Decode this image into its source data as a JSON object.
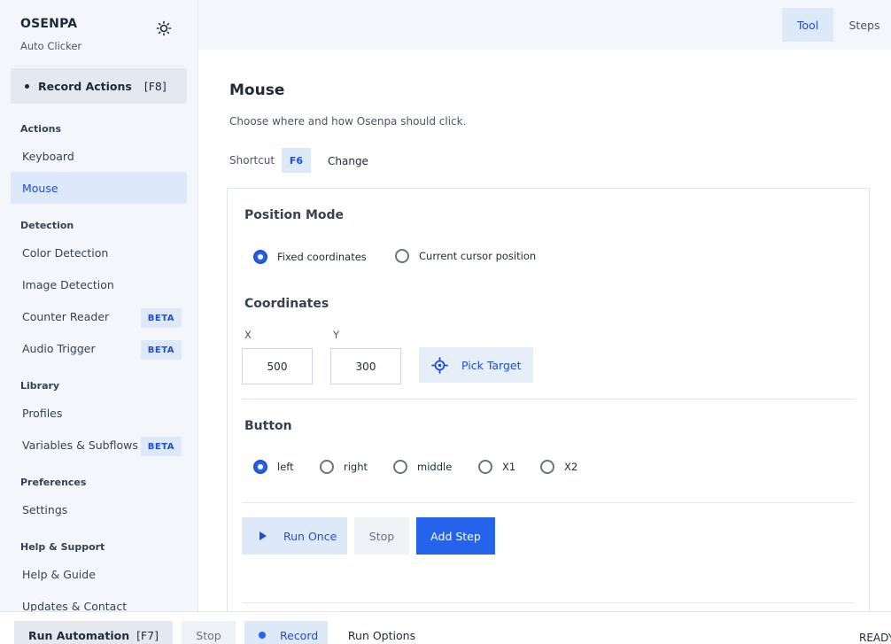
{
  "app": {
    "name": "OSENPA",
    "subtitle": "Auto Clicker"
  },
  "sidebar": {
    "record_actions": {
      "label": "Record Actions",
      "key": "[F8]"
    },
    "sections": {
      "actions": "Actions",
      "detection": "Detection",
      "library": "Library",
      "preferences": "Preferences",
      "help": "Help & Support"
    },
    "items": {
      "keyboard": "Keyboard",
      "mouse": "Mouse",
      "color_detection": "Color Detection",
      "image_detection": "Image Detection",
      "counter_reader": "Counter Reader",
      "audio_trigger": "Audio Trigger",
      "profiles": "Profiles",
      "variables": "Variables & Subflows",
      "settings": "Settings",
      "help_guide": "Help & Guide",
      "updates": "Updates & Contact"
    },
    "beta_label": "BETA",
    "active_item": "mouse"
  },
  "topbar": {
    "tabs": [
      "Tool",
      "Steps"
    ],
    "active_tab": "Tool"
  },
  "main": {
    "title": "Mouse",
    "description": "Choose where and how Osenpa should click.",
    "shortcut": {
      "label": "Shortcut",
      "key": "F6",
      "change": "Change"
    },
    "position_mode": {
      "title": "Position Mode",
      "options": [
        "Fixed coordinates",
        "Current cursor position"
      ],
      "selected": "Fixed coordinates"
    },
    "coordinates": {
      "title": "Coordinates",
      "x_label": "X",
      "y_label": "Y",
      "x_value": "500",
      "y_value": "300",
      "pick_target": "Pick Target"
    },
    "button": {
      "title": "Button",
      "options": [
        "left",
        "right",
        "middle",
        "X1",
        "X2"
      ],
      "selected": "left"
    },
    "actions": {
      "run_once": "Run Once",
      "stop": "Stop",
      "add_step": "Add Step"
    }
  },
  "bottombar": {
    "run_automation": "Run Automation",
    "run_key": "[F7]",
    "stop": "Stop",
    "record": "Record",
    "run_options": "Run Options",
    "status": "READY"
  },
  "colors": {
    "accent": "#2563eb",
    "accent_text": "#1d4ed8",
    "accent_light": "#dde8f8",
    "sidebar_bg": "#f3f6fa"
  }
}
